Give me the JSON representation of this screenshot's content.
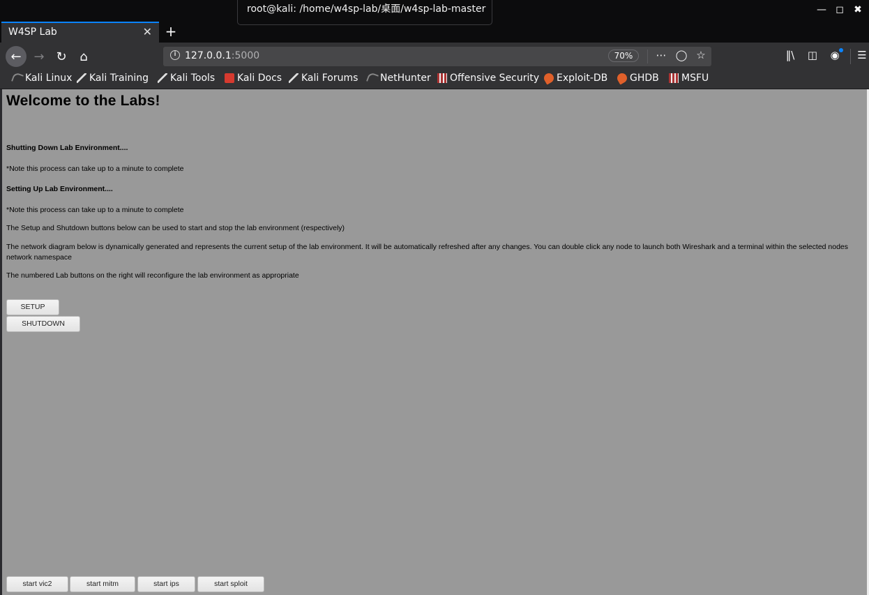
{
  "window": {
    "tooltip": "root@kali: /home/w4sp-lab/桌面/w4sp-lab-master",
    "controls": [
      "minimize",
      "maximize",
      "close"
    ]
  },
  "tabs": [
    {
      "title": "W4SP Lab",
      "close_icon": "close-icon"
    }
  ],
  "navbar": {
    "url_host": "127.0.0.1",
    "url_port": ":5000",
    "zoom": "70%"
  },
  "bookmarks": [
    {
      "label": "Kali Linux",
      "icon": "kali-icon"
    },
    {
      "label": "Kali Training",
      "icon": "kali-tool-icon"
    },
    {
      "label": "Kali Tools",
      "icon": "kali-tool-icon"
    },
    {
      "label": "Kali Docs",
      "icon": "docs-icon"
    },
    {
      "label": "Kali Forums",
      "icon": "kali-tool-icon"
    },
    {
      "label": "NetHunter",
      "icon": "kali-icon"
    },
    {
      "label": "Offensive Security",
      "icon": "offsec-icon"
    },
    {
      "label": "Exploit-DB",
      "icon": "exploitdb-icon"
    },
    {
      "label": "GHDB",
      "icon": "exploitdb-icon"
    },
    {
      "label": "MSFU",
      "icon": "offsec-icon"
    }
  ],
  "page": {
    "heading": "Welcome to the Labs!",
    "shutdown_status": "Shutting Down Lab Environment....",
    "shutdown_note": "*Note this process can take up to a minute to complete",
    "setup_status": "Setting Up Lab Environment....",
    "setup_note": "*Note this process can take up to a minute to complete",
    "info_buttons": "The Setup and Shutdown buttons below can be used to start and stop the lab environment (respectively)",
    "info_diagram": "The network diagram below is dynamically generated and represents the current setup of the lab environment. It will be automatically refreshed after any changes. You can double click any node to launch both Wireshark and a terminal within the selected nodes network namespace",
    "info_lab": "The numbered Lab buttons on the right will reconfigure the lab environment as appropriate",
    "setup_button": "SETUP",
    "shutdown_button": "SHUTDOWN",
    "lab_buttons": [
      "start vic2",
      "start mitm",
      "start ips",
      "start sploit"
    ]
  }
}
